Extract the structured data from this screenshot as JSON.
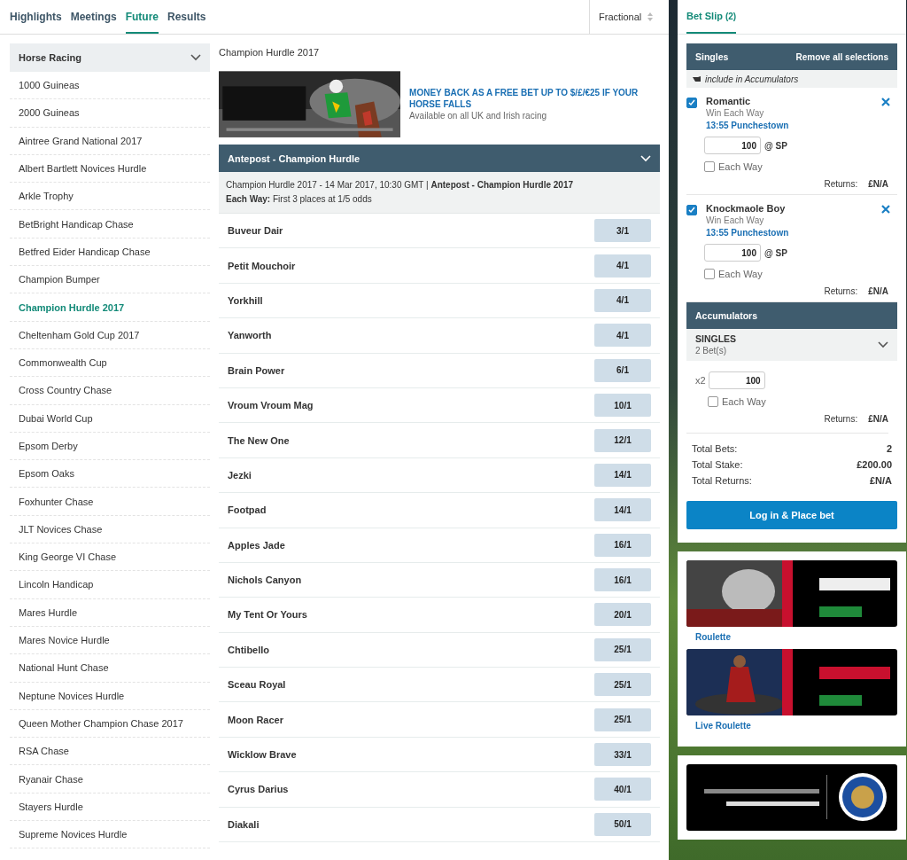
{
  "tabs": [
    {
      "label": "Highlights",
      "selected": false
    },
    {
      "label": "Meetings",
      "selected": false
    },
    {
      "label": "Future",
      "selected": true
    },
    {
      "label": "Results",
      "selected": false
    }
  ],
  "odds_format": "Fractional",
  "sidebar": {
    "title": "Horse Racing",
    "expanded": true,
    "items": [
      {
        "label": "1000 Guineas",
        "selected": false
      },
      {
        "label": "2000 Guineas",
        "selected": false
      },
      {
        "label": "Aintree Grand National 2017",
        "selected": false
      },
      {
        "label": "Albert Bartlett Novices Hurdle",
        "selected": false
      },
      {
        "label": "Arkle Trophy",
        "selected": false
      },
      {
        "label": "BetBright Handicap Chase",
        "selected": false
      },
      {
        "label": "Betfred Eider Handicap Chase",
        "selected": false
      },
      {
        "label": "Champion Bumper",
        "selected": false
      },
      {
        "label": "Champion Hurdle 2017",
        "selected": true
      },
      {
        "label": "Cheltenham Gold Cup 2017",
        "selected": false
      },
      {
        "label": "Commonwealth Cup",
        "selected": false
      },
      {
        "label": "Cross Country Chase",
        "selected": false
      },
      {
        "label": "Dubai World Cup",
        "selected": false
      },
      {
        "label": "Epsom Derby",
        "selected": false
      },
      {
        "label": "Epsom Oaks",
        "selected": false
      },
      {
        "label": "Foxhunter Chase",
        "selected": false
      },
      {
        "label": "JLT Novices Chase",
        "selected": false
      },
      {
        "label": "King George VI Chase",
        "selected": false
      },
      {
        "label": "Lincoln Handicap",
        "selected": false
      },
      {
        "label": "Mares Hurdle",
        "selected": false
      },
      {
        "label": "Mares Novice Hurdle",
        "selected": false
      },
      {
        "label": "National Hunt Chase",
        "selected": false
      },
      {
        "label": "Neptune Novices Hurdle",
        "selected": false
      },
      {
        "label": "Queen Mother Champion Chase 2017",
        "selected": false
      },
      {
        "label": "RSA Chase",
        "selected": false
      },
      {
        "label": "Ryanair Chase",
        "selected": false
      },
      {
        "label": "Stayers Hurdle",
        "selected": false
      },
      {
        "label": "Supreme Novices Hurdle",
        "selected": false
      }
    ]
  },
  "event": {
    "title": "Champion Hurdle 2017",
    "promo": {
      "headline": "MONEY BACK AS A FREE BET UP TO $/£/€25 IF YOUR HORSE FALLS",
      "subtext": "Available on all UK and Irish racing"
    },
    "market": {
      "title": "Antepost - Champion Hurdle",
      "expanded": true,
      "info": "Champion Hurdle 2017 - 14 Mar 2017, 10:30 GMT | **Antepost - Champion Hurdle 2017**",
      "each_way": "**Each Way:** First 3 places at 1/5 odds"
    },
    "runners": [
      {
        "name": "Buveur Dair",
        "odds": "3/1"
      },
      {
        "name": "Petit Mouchoir",
        "odds": "4/1"
      },
      {
        "name": "Yorkhill",
        "odds": "4/1"
      },
      {
        "name": "Yanworth",
        "odds": "4/1"
      },
      {
        "name": "Brain Power",
        "odds": "6/1"
      },
      {
        "name": "Vroum Vroum Mag",
        "odds": "10/1"
      },
      {
        "name": "The New One",
        "odds": "12/1"
      },
      {
        "name": "Jezki",
        "odds": "14/1"
      },
      {
        "name": "Footpad",
        "odds": "14/1"
      },
      {
        "name": "Apples Jade",
        "odds": "16/1"
      },
      {
        "name": "Nichols Canyon",
        "odds": "16/1"
      },
      {
        "name": "My Tent Or Yours",
        "odds": "20/1"
      },
      {
        "name": "Chtibello",
        "odds": "25/1"
      },
      {
        "name": "Sceau Royal",
        "odds": "25/1"
      },
      {
        "name": "Moon Racer",
        "odds": "25/1"
      },
      {
        "name": "Wicklow Brave",
        "odds": "33/1"
      },
      {
        "name": "Cyrus Darius",
        "odds": "40/1"
      },
      {
        "name": "Diakali",
        "odds": "50/1"
      }
    ]
  },
  "bet_slip": {
    "title": "Bet Slip",
    "count": "(2)",
    "singles_title": "Singles",
    "remove_all": "Remove all selections",
    "include_hint": "include in Accumulators",
    "selections": [
      {
        "name": "Romantic",
        "market": "Win Each Way",
        "race": "13:55 Punchestown",
        "stake": "100",
        "price": "@ SP",
        "include": true,
        "each_way_label": "Each Way",
        "each_way": false,
        "returns_label": "Returns:",
        "returns": "£N/A"
      },
      {
        "name": "Knockmaole Boy",
        "market": "Win Each Way",
        "race": "13:55 Punchestown",
        "stake": "100",
        "price": "@ SP",
        "include": true,
        "each_way_label": "Each Way",
        "each_way": false,
        "returns_label": "Returns:",
        "returns": "£N/A"
      }
    ],
    "accumulators": {
      "title": "Accumulators",
      "type": "SINGLES",
      "bets": "2 Bet(s)",
      "expanded": false,
      "multiplier": "x2",
      "stake": "100",
      "each_way_label": "Each Way",
      "each_way": false,
      "returns_label": "Returns:",
      "returns": "£N/A"
    },
    "totals": [
      {
        "label": "Total Bets:",
        "value": "2"
      },
      {
        "label": "Total Stake:",
        "value": "£200.00"
      },
      {
        "label": "Total Returns:",
        "value": "£N/A"
      }
    ],
    "place_bet": "Log in & Place bet"
  },
  "promos": [
    {
      "caption": "Roulette",
      "kind": "picture"
    },
    {
      "caption": "Live Roulette",
      "kind": "picture"
    }
  ]
}
